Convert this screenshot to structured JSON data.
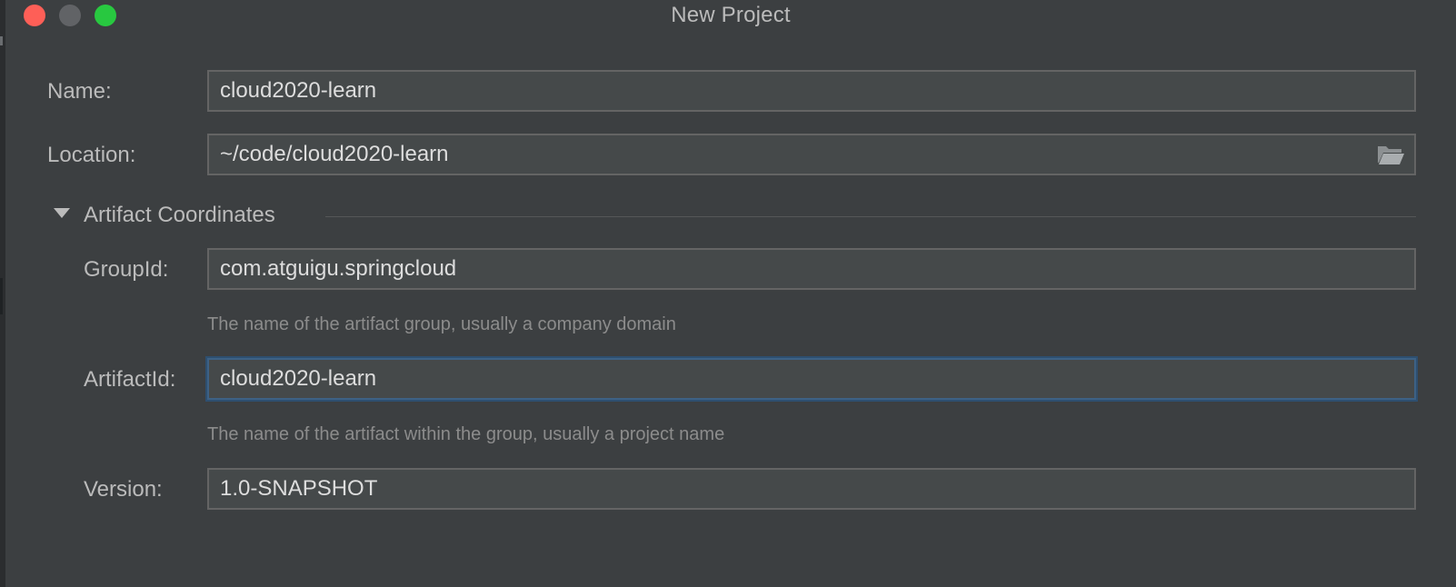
{
  "window": {
    "title": "New Project"
  },
  "form": {
    "name": {
      "label": "Name:",
      "value": "cloud2020-learn"
    },
    "location": {
      "label": "Location:",
      "value": "~/code/cloud2020-learn",
      "browse_icon": "folder-open-icon"
    },
    "artifact_section": {
      "title": "Artifact Coordinates",
      "expanded": true,
      "group_id": {
        "label": "GroupId:",
        "value": "com.atguigu.springcloud",
        "hint": "The name of the artifact group, usually a company domain"
      },
      "artifact_id": {
        "label": "ArtifactId:",
        "value": "cloud2020-learn",
        "hint": "The name of the artifact within the group, usually a project name",
        "focused": true
      },
      "version": {
        "label": "Version:",
        "value": "1.0-SNAPSHOT"
      }
    }
  },
  "colors": {
    "background": "#3c3f41",
    "field_background": "#45494a",
    "focus_border": "#3d6185",
    "close_button": "#fe5f57",
    "minimize_button": "#616366",
    "maximize_button": "#28c840"
  }
}
